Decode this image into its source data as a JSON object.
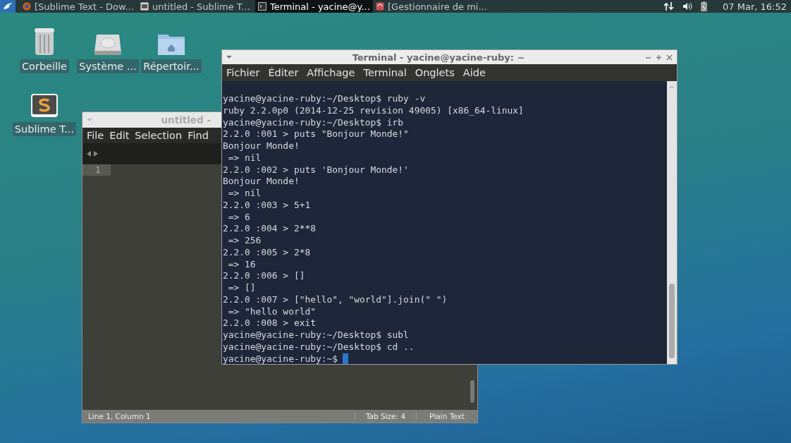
{
  "panel": {
    "tasks": [
      {
        "label": "[Sublime Text - Dow...",
        "selected": false,
        "kind": "browser"
      },
      {
        "label": "untitled - Sublime T...",
        "selected": false,
        "kind": "editor"
      },
      {
        "label": "Terminal - yacine@y...",
        "selected": true,
        "kind": "terminal"
      },
      {
        "label": "[Gestionnaire de mi...",
        "selected": false,
        "kind": "updater"
      }
    ],
    "clock": "07 Mar, 16:52"
  },
  "desktop_icons": [
    {
      "label": "Corbeille",
      "kind": "trash"
    },
    {
      "label": "Système ...",
      "kind": "drive"
    },
    {
      "label": "Répertoir...",
      "kind": "folder"
    },
    {
      "label": "Sublime T...",
      "kind": "sublime"
    }
  ],
  "editor_window": {
    "title": "untitled -",
    "menu": [
      "File",
      "Edit",
      "Selection",
      "Find"
    ],
    "line_number": "1",
    "status_bar": {
      "position": "Line 1, Column 1",
      "tab_size": "Tab Size: 4",
      "syntax": "Plain Text"
    }
  },
  "terminal_window": {
    "title": "Terminal - yacine@yacine-ruby: ~",
    "menu": [
      "Fichier",
      "Éditer",
      "Affichage",
      "Terminal",
      "Onglets",
      "Aide"
    ],
    "lines": [
      "yacine@yacine-ruby:~/Desktop$ ruby -v",
      "ruby 2.2.0p0 (2014-12-25 revision 49005) [x86_64-linux]",
      "yacine@yacine-ruby:~/Desktop$ irb",
      "2.2.0 :001 > puts \"Bonjour Monde!\"",
      "Bonjour Monde!",
      " => nil",
      "2.2.0 :002 > puts 'Bonjour Monde!'",
      "Bonjour Monde!",
      " => nil",
      "2.2.0 :003 > 5+1",
      " => 6",
      "2.2.0 :004 > 2**8",
      " => 256",
      "2.2.0 :005 > 2*8",
      " => 16",
      "2.2.0 :006 > []",
      " => []",
      "2.2.0 :007 > [\"hello\", \"world\"].join(\" \")",
      " => \"hello world\"",
      "2.2.0 :008 > exit",
      "yacine@yacine-ruby:~/Desktop$ subl",
      "yacine@yacine-ruby:~/Desktop$ cd ..",
      "yacine@yacine-ruby:~$ "
    ]
  }
}
